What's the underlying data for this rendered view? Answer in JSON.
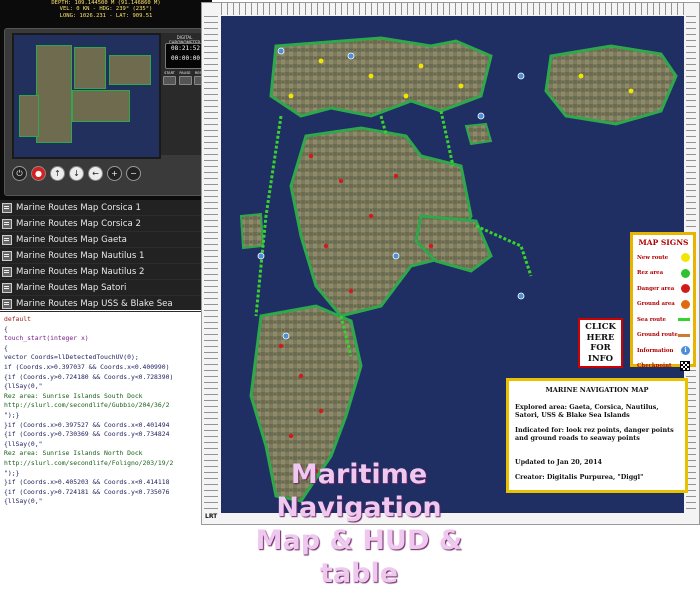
{
  "hud": {
    "readout": [
      "DEPTH: 109.144500 M  (91.146860 M)",
      "VEL: 0 KN   -   HDG: 239° (235°)",
      "LONG: 1026.231  -  LAT: 909.51"
    ],
    "panel_label": "DIGITAL CHRONOMETER",
    "clock_time": "08:21:52",
    "clock_timer": "00:00:00",
    "small_buttons": [
      "START",
      "PAUSE",
      "RESET"
    ],
    "buttons": [
      {
        "name": "power-icon",
        "glyph": "⏻"
      },
      {
        "name": "stop-icon",
        "glyph": "●"
      },
      {
        "name": "up-arrow-icon",
        "glyph": "↑"
      },
      {
        "name": "down-arrow-icon",
        "glyph": "↓"
      },
      {
        "name": "left-arrow-icon",
        "glyph": "←"
      },
      {
        "name": "zoom-in-icon",
        "glyph": "+"
      },
      {
        "name": "zoom-out-icon",
        "glyph": "−"
      }
    ]
  },
  "menu": {
    "items": [
      "Marine Routes Map Corsica 1",
      "Marine Routes Map Corsica 2",
      "Marine Routes Map Gaeta",
      "Marine Routes Map Nautilus 1",
      "Marine Routes Map Nautilus 2",
      "Marine Routes Map Satori",
      "Marine Routes Map USS & Blake Sea"
    ]
  },
  "script": {
    "lines": [
      {
        "t": "default",
        "c": "kw"
      },
      {
        "t": "{",
        "c": ""
      },
      {
        "t": "touch_start(integer x)",
        "c": "fn"
      },
      {
        "t": "{",
        "c": ""
      },
      {
        "t": "vector Coords=llDetectedTouchUV(0);",
        "c": ""
      },
      {
        "t": "if (Coords.x>0.397037 && Coords.x<0.400990)",
        "c": ""
      },
      {
        "t": "{if (Coords.y>0.724180 && Coords.y<0.728390)",
        "c": ""
      },
      {
        "t": "{llSay(0,\"",
        "c": ""
      },
      {
        "t": "Rez area: Sunrise Islands South Dock",
        "c": "str"
      },
      {
        "t": "http://slurl.com/secondlife/Gubbio/204/36/2",
        "c": "str"
      },
      {
        "t": "\");}",
        "c": ""
      },
      {
        "t": "}if (Coords.x>0.397527 && Coords.x<0.401494",
        "c": ""
      },
      {
        "t": "{if (Coords.y>0.730369 && Coords.y<0.734824",
        "c": ""
      },
      {
        "t": "{llSay(0,\"",
        "c": ""
      },
      {
        "t": "Rez area: Sunrise Islands North Dock",
        "c": "str"
      },
      {
        "t": "http://slurl.com/secondlife/Foligno/203/19/2",
        "c": "str"
      },
      {
        "t": "\");}",
        "c": ""
      },
      {
        "t": "}if (Coords.x>0.405203 && Coords.x<0.414118",
        "c": ""
      },
      {
        "t": "{if (Coords.y>0.724181 && Coords.y<0.735076",
        "c": ""
      },
      {
        "t": "{llSay(0,\"",
        "c": ""
      }
    ]
  },
  "map": {
    "signs_title": "MAP SIGNS",
    "signs": [
      {
        "label": "New route",
        "color": "#f2e600",
        "shape": "dot"
      },
      {
        "label": "Rez area",
        "color": "#2fc22f",
        "shape": "dot"
      },
      {
        "label": "Danger area",
        "color": "#d21a1a",
        "shape": "dot"
      },
      {
        "label": "Ground area",
        "color": "#e06a10",
        "shape": "dot"
      },
      {
        "label": "Sea route",
        "color": "#39d12f",
        "shape": "bar"
      },
      {
        "label": "Ground route",
        "color": "#d07a30",
        "shape": "bar"
      },
      {
        "label": "Information",
        "color": "#4a8fd8",
        "shape": "info"
      },
      {
        "label": "Checkpoint",
        "color": "#000000",
        "shape": "check"
      }
    ],
    "click_box": [
      "CLICK",
      "HERE",
      "FOR",
      "INFO"
    ],
    "info_box": {
      "title": "MARINE NAVIGATION MAP",
      "explored": "Explored area:  Gaeta, Corsica, Nautilus, Satori, USS & Blake Sea Islands",
      "indicated": "Indicated for:  look rez points, danger points and ground roads to seaway points",
      "updated": "Updated to Jan 20, 2014",
      "creator": "Creator: Digitalis Purpurea, \"Diggl\""
    },
    "corner_label": "LRT"
  },
  "overlay_title": [
    "Maritime Navigation",
    "Map & HUD & table"
  ]
}
